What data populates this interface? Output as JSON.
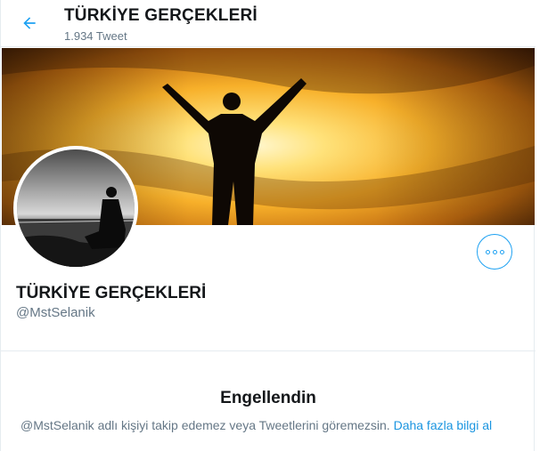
{
  "header": {
    "title": "TÜRKİYE GERÇEKLERİ",
    "tweet_count": "1.934 Tweet"
  },
  "profile": {
    "name": "TÜRKİYE GERÇEKLERİ",
    "handle": "@MstSelanik"
  },
  "blocked": {
    "title": "Engellendin",
    "message": "@MstSelanik adlı kişiyi takip edemez veya Tweetlerini göremezsin.",
    "link": "Daha fazla bilgi al"
  },
  "colors": {
    "accent": "#1da1f2",
    "link": "#1b95e0",
    "secondary_text": "#657786",
    "primary_text": "#14171a",
    "border": "#e6ecf0"
  },
  "icons": {
    "back": "arrow-left-icon",
    "more": "more-horizontal-icon"
  }
}
